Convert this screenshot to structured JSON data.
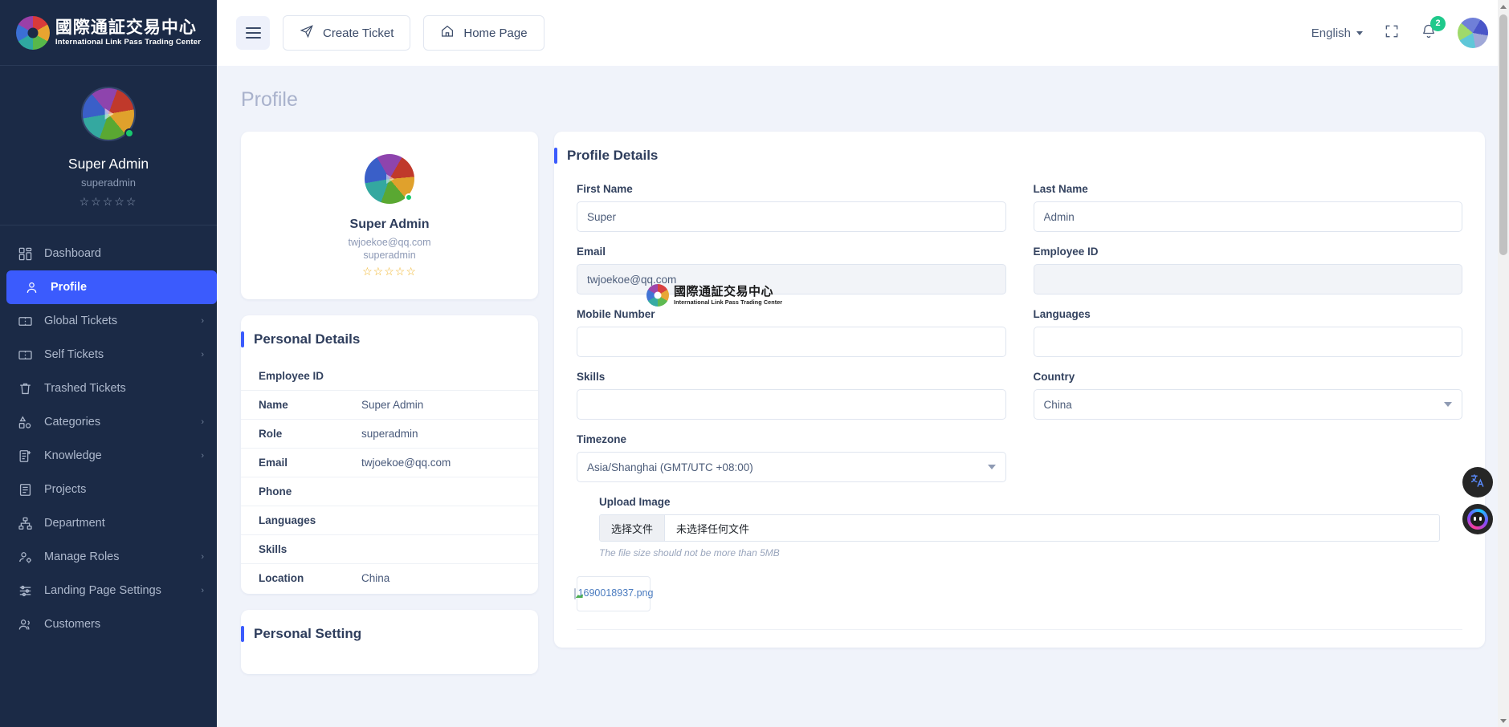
{
  "brand": {
    "cn_name": "國際通証交易中心",
    "en_name": "International Link Pass Trading Center"
  },
  "sidebar": {
    "user": {
      "name": "Super Admin",
      "role": "superadmin",
      "stars": "☆☆☆☆☆"
    },
    "items": [
      {
        "label": "Dashboard",
        "icon": "grid-icon",
        "active": false,
        "chevron": ""
      },
      {
        "label": "Profile",
        "icon": "user-icon",
        "active": true,
        "chevron": ""
      },
      {
        "label": "Global Tickets",
        "icon": "ticket-icon",
        "active": false,
        "chevron": "›"
      },
      {
        "label": "Self Tickets",
        "icon": "ticket-icon",
        "active": false,
        "chevron": "›"
      },
      {
        "label": "Trashed Tickets",
        "icon": "trash-icon",
        "active": false,
        "chevron": ""
      },
      {
        "label": "Categories",
        "icon": "shapes-icon",
        "active": false,
        "chevron": "›"
      },
      {
        "label": "Knowledge",
        "icon": "doc-plus-icon",
        "active": false,
        "chevron": "›"
      },
      {
        "label": "Projects",
        "icon": "document-icon",
        "active": false,
        "chevron": ""
      },
      {
        "label": "Department",
        "icon": "sitemap-icon",
        "active": false,
        "chevron": ""
      },
      {
        "label": "Manage Roles",
        "icon": "user-gear-icon",
        "active": false,
        "chevron": "›"
      },
      {
        "label": "Landing Page Settings",
        "icon": "sliders-icon",
        "active": false,
        "chevron": "›"
      },
      {
        "label": "Customers",
        "icon": "users-icon",
        "active": false,
        "chevron": ""
      }
    ]
  },
  "topbar": {
    "menu_toggle": "hamburger-icon",
    "create_ticket_label": "Create Ticket",
    "home_page_label": "Home Page",
    "language": "English",
    "fullscreen_icon": "fullscreen-icon",
    "notifications_icon": "bell-icon",
    "notification_count": "2"
  },
  "page": {
    "title": "Profile"
  },
  "profile_card": {
    "name": "Super Admin",
    "email": "twjoekoe@qq.com",
    "role": "superadmin",
    "stars": "☆☆☆☆☆"
  },
  "personal_details": {
    "heading": "Personal Details",
    "rows": [
      {
        "key": "Employee ID",
        "value": ""
      },
      {
        "key": "Name",
        "value": "Super Admin"
      },
      {
        "key": "Role",
        "value": "superadmin"
      },
      {
        "key": "Email",
        "value": "twjoekoe@qq.com"
      },
      {
        "key": "Phone",
        "value": ""
      },
      {
        "key": "Languages",
        "value": ""
      },
      {
        "key": "Skills",
        "value": ""
      },
      {
        "key": "Location",
        "value": "China"
      }
    ]
  },
  "personal_setting": {
    "heading": "Personal Setting"
  },
  "profile_details": {
    "heading": "Profile Details",
    "fields": {
      "first_name": {
        "label": "First Name",
        "value": "Super",
        "placeholder": ""
      },
      "last_name": {
        "label": "Last Name",
        "value": "Admin",
        "placeholder": ""
      },
      "email": {
        "label": "Email",
        "value": "twjoekoe@qq.com",
        "placeholder": "",
        "disabled": true
      },
      "employee_id": {
        "label": "Employee ID",
        "value": "",
        "placeholder": "",
        "disabled": true
      },
      "mobile": {
        "label": "Mobile Number",
        "value": "",
        "placeholder": ""
      },
      "languages": {
        "label": "Languages",
        "value": "",
        "placeholder": ""
      },
      "skills": {
        "label": "Skills",
        "value": "",
        "placeholder": ""
      },
      "country": {
        "label": "Country",
        "value": "China"
      },
      "timezone": {
        "label": "Timezone",
        "value": "Asia/Shanghai (GMT/UTC +08:00)"
      }
    },
    "upload": {
      "label": "Upload Image",
      "choose_button": "选择文件",
      "no_file_text": "未选择任何文件",
      "hint": "The file size should not be more than 5MB",
      "thumbnail_name": "1690018937.png"
    }
  },
  "watermark": {
    "cn_name": "國際通証交易中心",
    "en_name": "International Link Pass Trading Center"
  },
  "floating": {
    "translate_icon": "translate-icon",
    "chat_icon": "chat-bot-icon"
  },
  "colors": {
    "accent": "#3b5bfd",
    "sidebar_bg": "#1b2a46",
    "page_bg": "#f0f3fa",
    "badge_green": "#1fc98b",
    "star_gold": "#f0b429"
  }
}
